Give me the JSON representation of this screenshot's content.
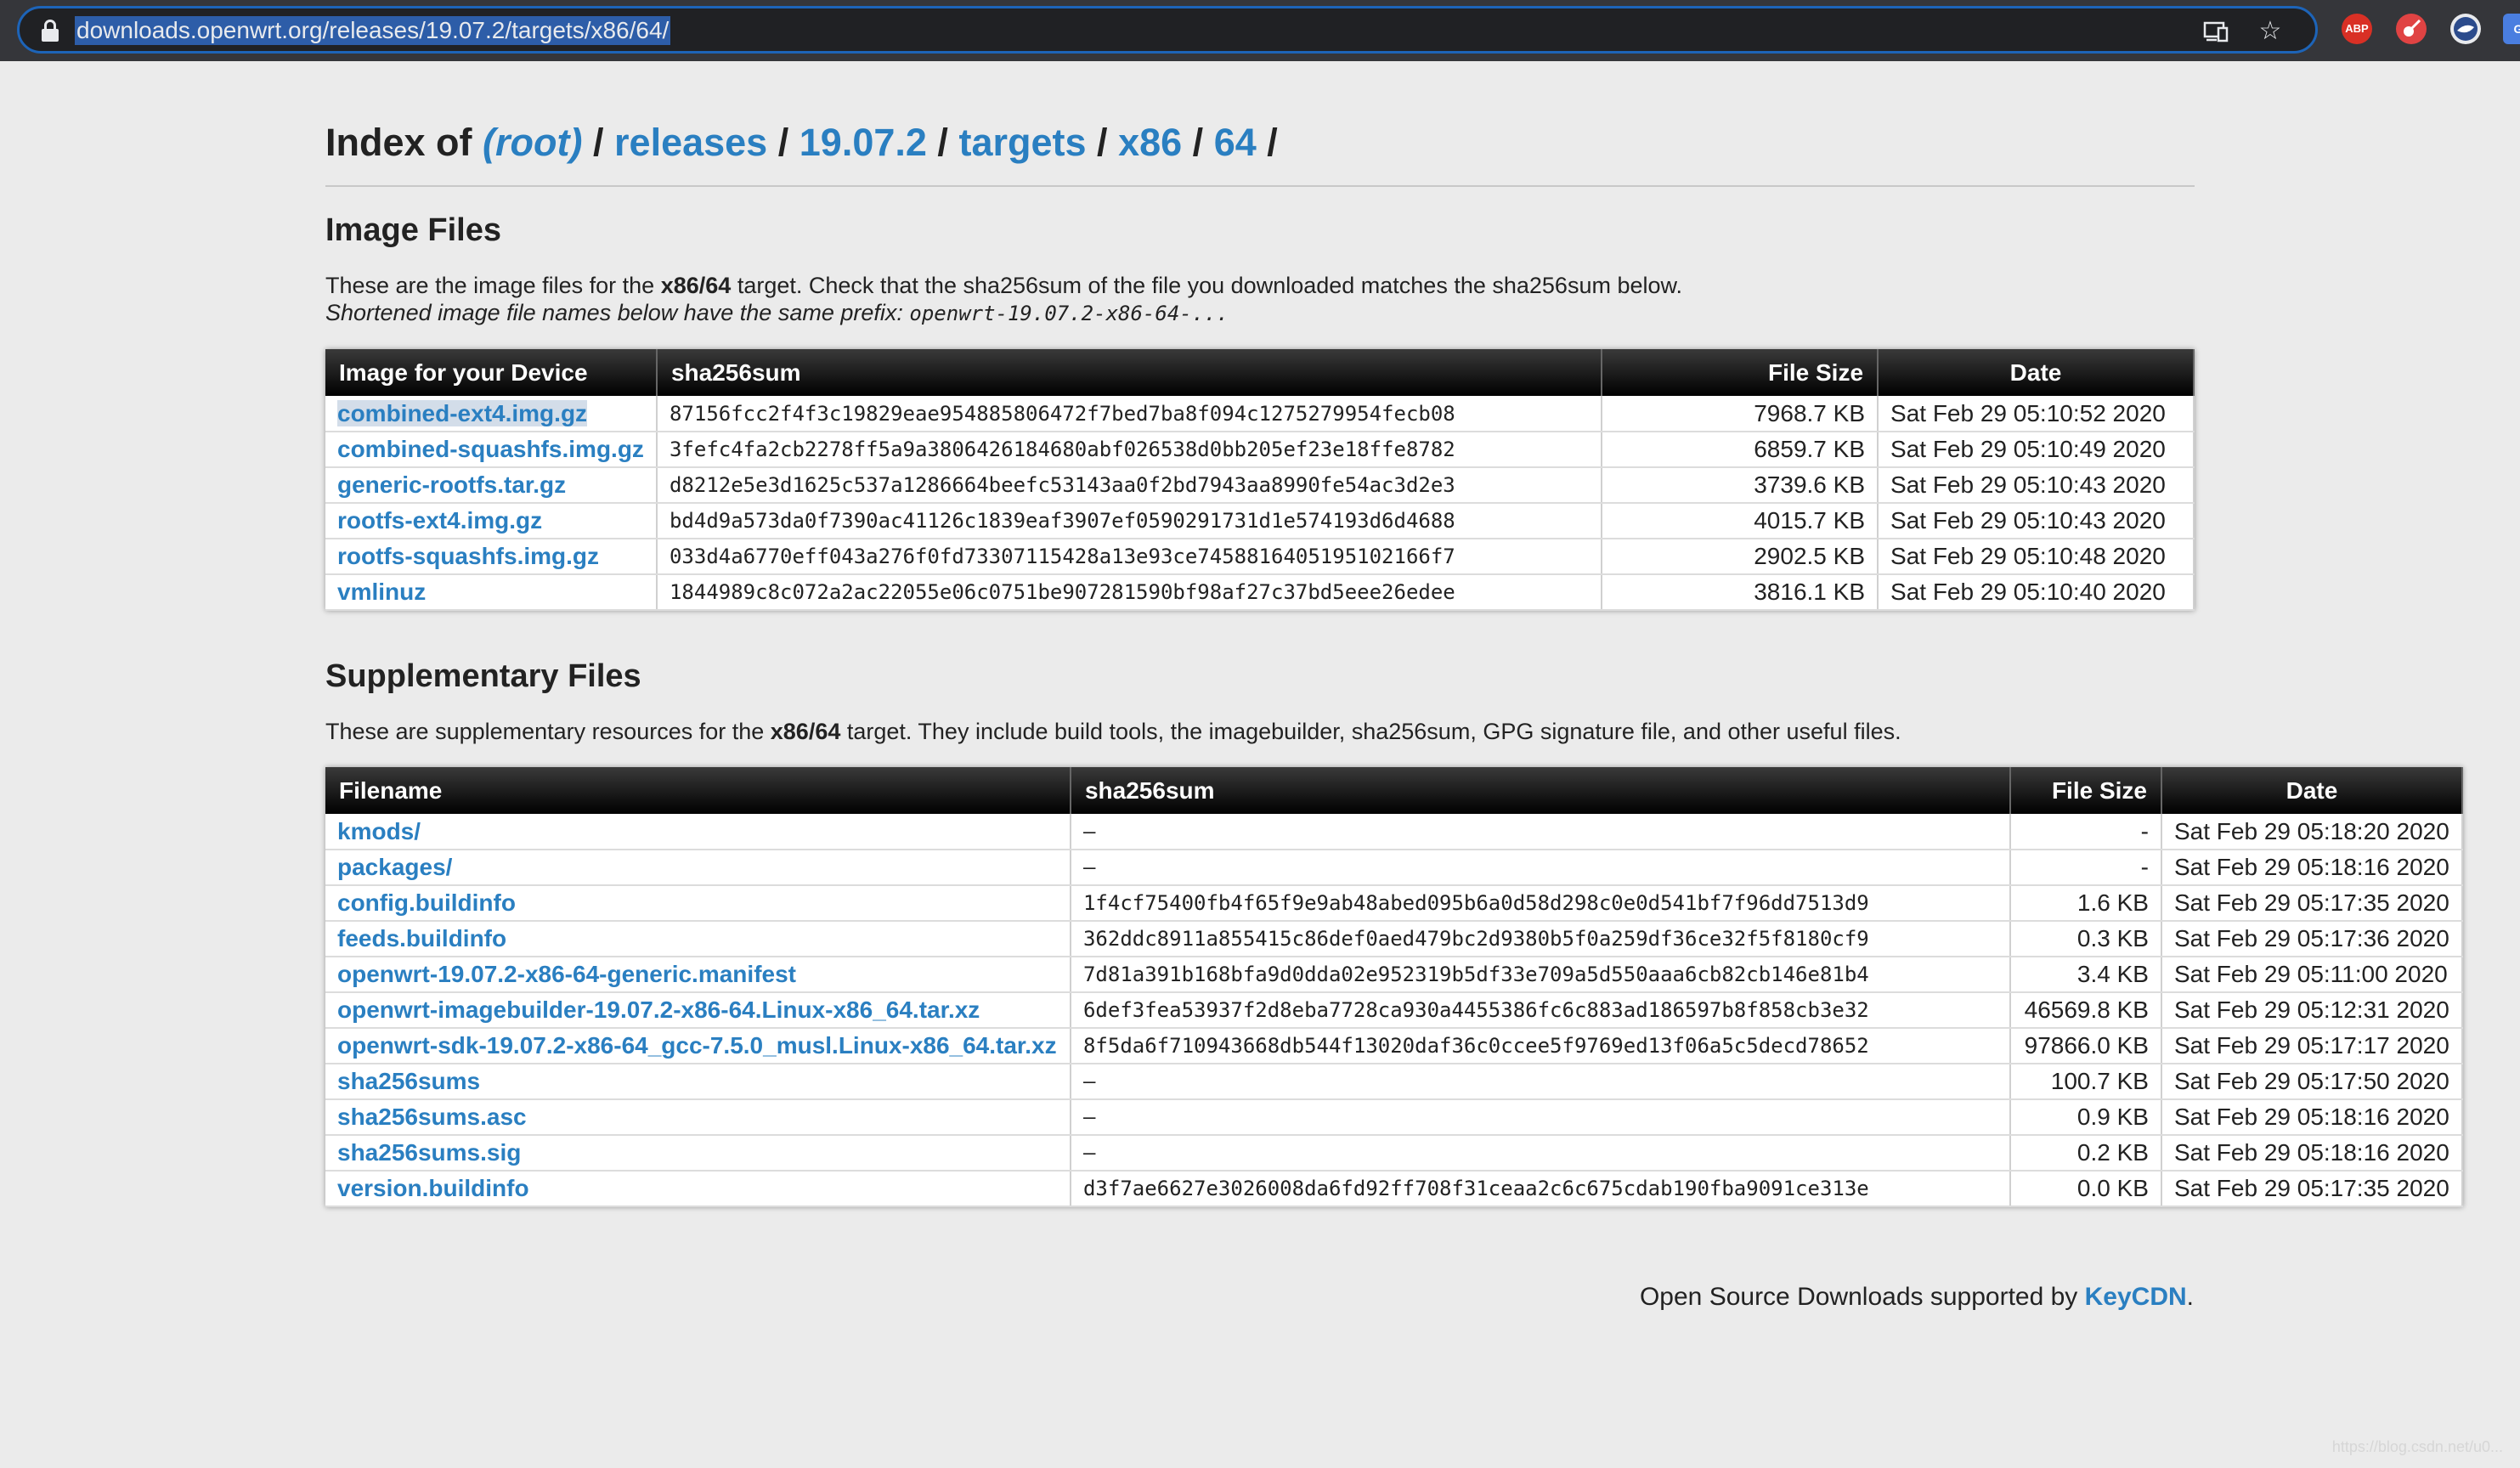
{
  "browser": {
    "url": "downloads.openwrt.org/releases/19.07.2/targets/x86/64/",
    "extensions": [
      {
        "name": "adblock-plus-icon",
        "label": "ABP",
        "color": "#e42f2f"
      },
      {
        "name": "guitar-extension-icon",
        "label": "",
        "color": "#e03c3c"
      },
      {
        "name": "globe-extension-icon",
        "label": "",
        "color": "#e8eaed"
      },
      {
        "name": "google-translate-icon",
        "label": "G",
        "color": "#4a7ee0"
      }
    ]
  },
  "header": {
    "prefix": "Index of",
    "crumbs": [
      "(root)",
      "releases",
      "19.07.2",
      "targets",
      "x86",
      "64"
    ],
    "sep": "/"
  },
  "image_section": {
    "title": "Image Files",
    "desc_before": "These are the image files for the ",
    "desc_bold": "x86/64",
    "desc_after": " target. Check that the sha256sum of the file you downloaded matches the sha256sum below.",
    "note": "Shortened image file names below have the same prefix: ",
    "prefix_code": "openwrt-19.07.2-x86-64-...",
    "columns": [
      "Image for your Device",
      "sha256sum",
      "File Size",
      "Date"
    ],
    "rows": [
      {
        "name": "combined-ext4.img.gz",
        "sha": "87156fcc2f4f3c19829eae954885806472f7bed7ba8f094c1275279954fecb08",
        "size": "7968.7 KB",
        "date": "Sat Feb 29 05:10:52 2020"
      },
      {
        "name": "combined-squashfs.img.gz",
        "sha": "3fefc4fa2cb2278ff5a9a3806426184680abf026538d0bb205ef23e18ffe8782",
        "size": "6859.7 KB",
        "date": "Sat Feb 29 05:10:49 2020"
      },
      {
        "name": "generic-rootfs.tar.gz",
        "sha": "d8212e5e3d1625c537a1286664beefc53143aa0f2bd7943aa8990fe54ac3d2e3",
        "size": "3739.6 KB",
        "date": "Sat Feb 29 05:10:43 2020"
      },
      {
        "name": "rootfs-ext4.img.gz",
        "sha": "bd4d9a573da0f7390ac41126c1839eaf3907ef0590291731d1e574193d6d4688",
        "size": "4015.7 KB",
        "date": "Sat Feb 29 05:10:43 2020"
      },
      {
        "name": "rootfs-squashfs.img.gz",
        "sha": "033d4a6770eff043a276f0fd73307115428a13e93ce7458816405195102166f7",
        "size": "2902.5 KB",
        "date": "Sat Feb 29 05:10:48 2020"
      },
      {
        "name": "vmlinuz",
        "sha": "1844989c8c072a2ac22055e06c0751be907281590bf98af27c37bd5eee26edee",
        "size": "3816.1 KB",
        "date": "Sat Feb 29 05:10:40 2020"
      }
    ]
  },
  "supp_section": {
    "title": "Supplementary Files",
    "desc_before": "These are supplementary resources for the ",
    "desc_bold": "x86/64",
    "desc_after": " target. They include build tools, the imagebuilder, sha256sum, GPG signature file, and other useful files.",
    "columns": [
      "Filename",
      "sha256sum",
      "File Size",
      "Date"
    ],
    "rows": [
      {
        "name": "kmods/",
        "sha": "–",
        "size": "-",
        "date": "Sat Feb 29 05:18:20 2020"
      },
      {
        "name": "packages/",
        "sha": "–",
        "size": "-",
        "date": "Sat Feb 29 05:18:16 2020"
      },
      {
        "name": "config.buildinfo",
        "sha": "1f4cf75400fb4f65f9e9ab48abed095b6a0d58d298c0e0d541bf7f96dd7513d9",
        "size": "1.6 KB",
        "date": "Sat Feb 29 05:17:35 2020"
      },
      {
        "name": "feeds.buildinfo",
        "sha": "362ddc8911a855415c86def0aed479bc2d9380b5f0a259df36ce32f5f8180cf9",
        "size": "0.3 KB",
        "date": "Sat Feb 29 05:17:36 2020"
      },
      {
        "name": "openwrt-19.07.2-x86-64-generic.manifest",
        "sha": "7d81a391b168bfa9d0dda02e952319b5df33e709a5d550aaa6cb82cb146e81b4",
        "size": "3.4 KB",
        "date": "Sat Feb 29 05:11:00 2020"
      },
      {
        "name": "openwrt-imagebuilder-19.07.2-x86-64.Linux-x86_64.tar.xz",
        "sha": "6def3fea53937f2d8eba7728ca930a4455386fc6c883ad186597b8f858cb3e32",
        "size": "46569.8 KB",
        "date": "Sat Feb 29 05:12:31 2020"
      },
      {
        "name": "openwrt-sdk-19.07.2-x86-64_gcc-7.5.0_musl.Linux-x86_64.tar.xz",
        "sha": "8f5da6f710943668db544f13020daf36c0ccee5f9769ed13f06a5c5decd78652",
        "size": "97866.0 KB",
        "date": "Sat Feb 29 05:17:17 2020"
      },
      {
        "name": "sha256sums",
        "sha": "–",
        "size": "100.7 KB",
        "date": "Sat Feb 29 05:17:50 2020"
      },
      {
        "name": "sha256sums.asc",
        "sha": "–",
        "size": "0.9 KB",
        "date": "Sat Feb 29 05:18:16 2020"
      },
      {
        "name": "sha256sums.sig",
        "sha": "–",
        "size": "0.2 KB",
        "date": "Sat Feb 29 05:18:16 2020"
      },
      {
        "name": "version.buildinfo",
        "sha": "d3f7ae6627e3026008da6fd92ff708f31ceaa2c6c675cdab190fba9091ce313e",
        "size": "0.0 KB",
        "date": "Sat Feb 29 05:17:35 2020"
      }
    ]
  },
  "footer": {
    "text": "Open Source Downloads supported by ",
    "link": "KeyCDN",
    "period": "."
  },
  "watermark": "https://blog.csdn.net/u0..."
}
